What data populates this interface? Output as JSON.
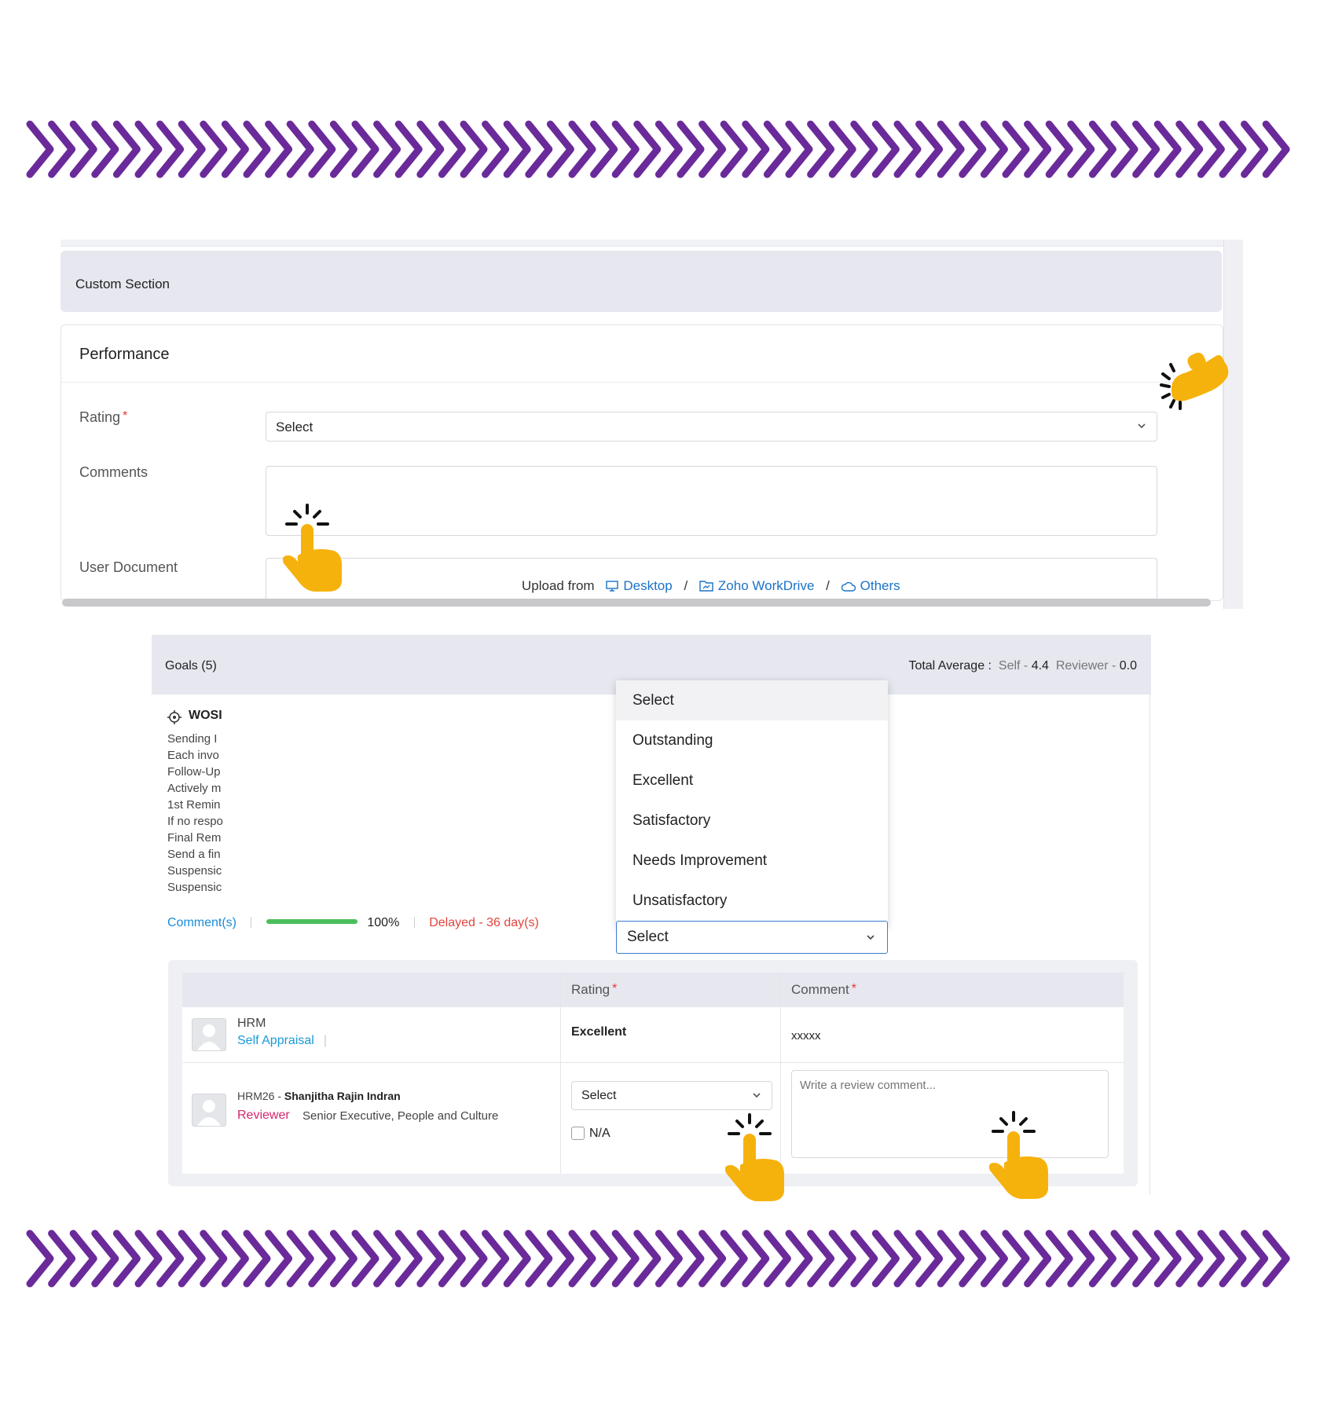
{
  "custom_section": {
    "title": "Custom Section"
  },
  "performance": {
    "title": "Performance",
    "rating_label": "Rating",
    "required_mark": "*",
    "rating_value": "Select",
    "comments_label": "Comments",
    "user_document_label": "User Document",
    "upload": {
      "prefix": "Upload from",
      "desktop": "Desktop",
      "separator": "/",
      "workdrive": "Zoho WorkDrive",
      "others": "Others"
    }
  },
  "goals": {
    "title": "Goals (5)",
    "total_average_label": "Total Average :",
    "self_label": "Self -",
    "self_value": "4.4",
    "reviewer_label": "Reviewer -",
    "reviewer_value": "0.0",
    "goal_title": "WOSI",
    "goal_lines": [
      "Sending I",
      "Each invo",
      "Follow-Up",
      "Actively m",
      "1st Remin",
      "If no respo",
      "Final Rem",
      "Send a fin",
      "Suspensic",
      "Suspensic"
    ],
    "comments_link": "Comment(s)",
    "progress": 1.0,
    "progress_text": "100%",
    "delayed_text": "Delayed - 36 day(s)"
  },
  "rating_dropdown": {
    "options": [
      "Select",
      "Outstanding",
      "Excellent",
      "Satisfactory",
      "Needs Improvement",
      "Unsatisfactory"
    ],
    "selected": "Select"
  },
  "review_table": {
    "headers": {
      "rating": "Rating",
      "comment": "Comment"
    },
    "rows": [
      {
        "name": "HRM",
        "role": "Self Appraisal",
        "rating": "Excellent",
        "comment": "xxxxx"
      },
      {
        "id": "HRM26 -",
        "name": "Shanjitha Rajin Indran",
        "role": "Reviewer",
        "designation": "Senior Executive, People and Culture",
        "rating_select": "Select",
        "na_label": "N/A",
        "comment_placeholder": "Write a review comment..."
      }
    ]
  },
  "colors": {
    "chevron": "#6a2a9a",
    "hand": "#f6b20c",
    "link": "#1a73c9",
    "accent_header": "#e6e7ef"
  },
  "icons": [
    "chevron-arrow-icon",
    "chevron-down-icon",
    "desktop-icon",
    "workdrive-icon",
    "cloud-icon",
    "target-icon",
    "avatar-icon",
    "pointing-hand-icon"
  ]
}
